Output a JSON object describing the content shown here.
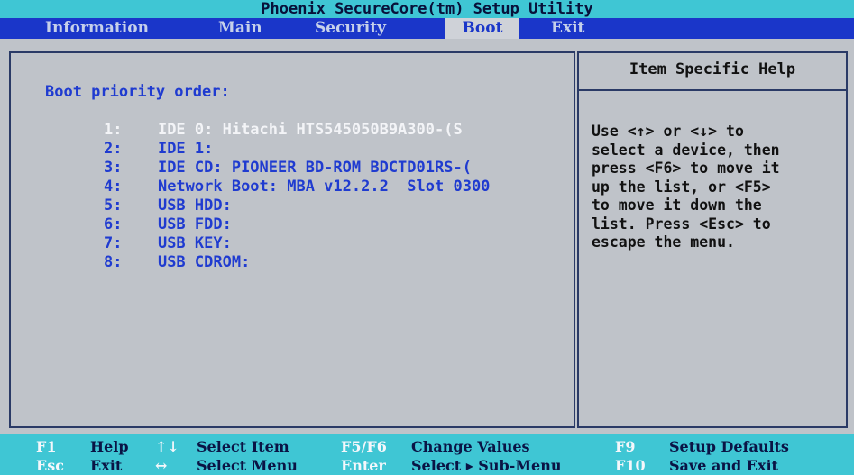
{
  "title": "Phoenix SecureCore(tm) Setup Utility",
  "menu": [
    "Information",
    "Main",
    "Security",
    "Boot",
    "Exit"
  ],
  "active_menu": "Boot",
  "boot": {
    "section_title": "Boot priority order:",
    "items": [
      {
        "num": "1:",
        "label": "IDE 0: Hitachi HTS545050B9A300-(S"
      },
      {
        "num": "2:",
        "label": "IDE 1:"
      },
      {
        "num": "3:",
        "label": "IDE CD: PIONEER BD-ROM BDCTD01RS-("
      },
      {
        "num": "4:",
        "label": "Network Boot: MBA v12.2.2  Slot 0300"
      },
      {
        "num": "5:",
        "label": "USB HDD:"
      },
      {
        "num": "6:",
        "label": "USB FDD:"
      },
      {
        "num": "7:",
        "label": "USB KEY:"
      },
      {
        "num": "8:",
        "label": "USB CDROM:"
      }
    ]
  },
  "help": {
    "title": "Item Specific Help",
    "body": "Use <↑> or <↓> to\nselect a device, then\npress <F6> to move it\nup the list, or <F5>\nto move it down the\nlist. Press <Esc> to\nescape the menu."
  },
  "keys": [
    {
      "key": "F1",
      "label": "Help"
    },
    {
      "key": "Esc",
      "label": "Exit"
    },
    {
      "key": "↑↓",
      "label": "Select Item"
    },
    {
      "key": "↔",
      "label": "Select Menu"
    },
    {
      "key": "F5/F6",
      "label": "Change Values"
    },
    {
      "key": "Enter",
      "label": "Select ▸ Sub-Menu"
    },
    {
      "key": "F9",
      "label": "Setup Defaults"
    },
    {
      "key": "F10",
      "label": "Save and Exit"
    }
  ],
  "colors": {
    "background": "#bfc3c9",
    "title_bar": "#3fc6d4",
    "menu_bar": "#1a36c9",
    "text_blue": "#1f3bd0",
    "selected_text": "#f3f4f7"
  }
}
